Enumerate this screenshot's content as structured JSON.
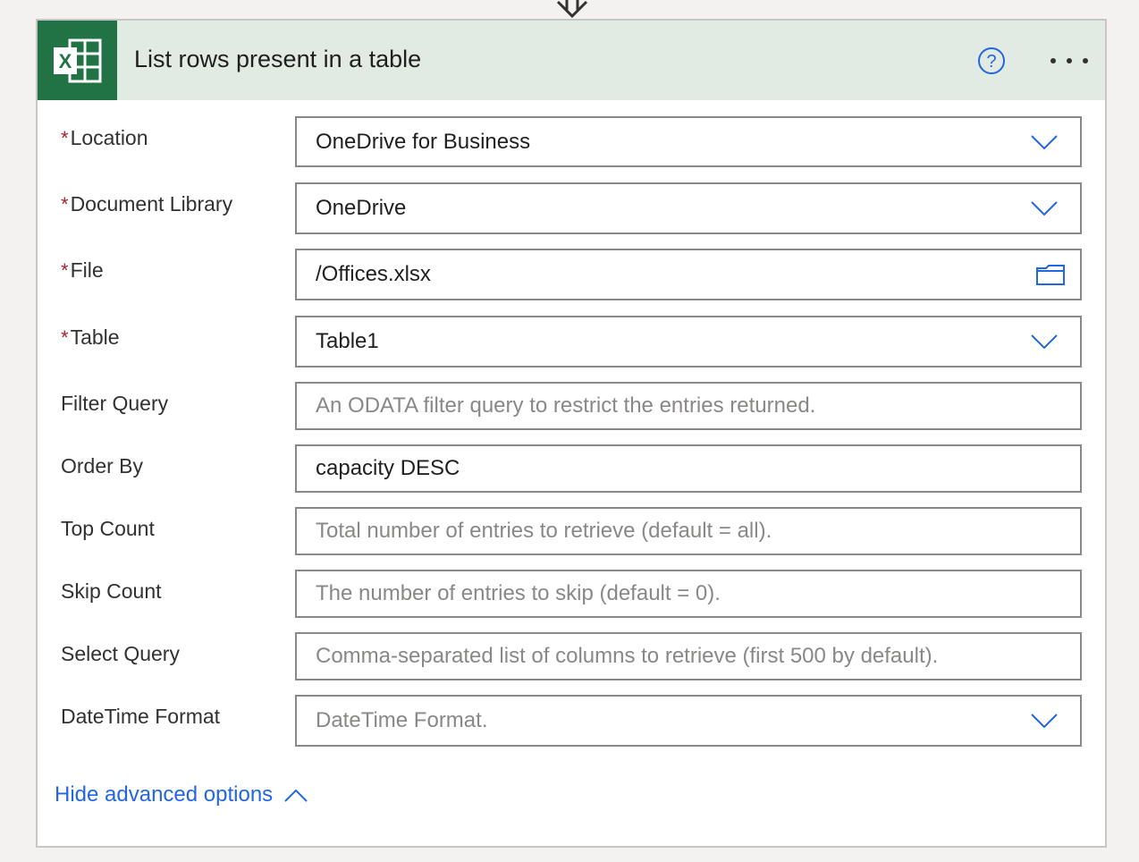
{
  "action": {
    "title": "List rows present in a table",
    "icons": {
      "app": "excel-icon",
      "help": "help-circle-icon",
      "more": "ellipsis-icon",
      "connector": "down-arrow-icon"
    },
    "colors": {
      "header_bg": "#e1ebe3",
      "excel_green": "#217346",
      "accent_blue": "#2266e3",
      "required_red": "#a4262c"
    }
  },
  "fields": [
    {
      "label": "Location",
      "required": true,
      "value": "OneDrive for Business",
      "placeholder": "",
      "control": "dropdown"
    },
    {
      "label": "Document Library",
      "required": true,
      "value": "OneDrive",
      "placeholder": "",
      "control": "dropdown"
    },
    {
      "label": "File",
      "required": true,
      "value": "/Offices.xlsx",
      "placeholder": "",
      "control": "file-picker"
    },
    {
      "label": "Table",
      "required": true,
      "value": "Table1",
      "placeholder": "",
      "control": "dropdown"
    },
    {
      "label": "Filter Query",
      "required": false,
      "value": "",
      "placeholder": "An ODATA filter query to restrict the entries returned.",
      "control": "text"
    },
    {
      "label": "Order By",
      "required": false,
      "value": "capacity DESC",
      "placeholder": "",
      "control": "text"
    },
    {
      "label": "Top Count",
      "required": false,
      "value": "",
      "placeholder": "Total number of entries to retrieve (default = all).",
      "control": "text"
    },
    {
      "label": "Skip Count",
      "required": false,
      "value": "",
      "placeholder": "The number of entries to skip (default = 0).",
      "control": "text"
    },
    {
      "label": "Select Query",
      "required": false,
      "value": "",
      "placeholder": "Comma-separated list of columns to retrieve (first 500 by default).",
      "control": "text"
    },
    {
      "label": "DateTime Format",
      "required": false,
      "value": "",
      "placeholder": "DateTime Format.",
      "control": "dropdown"
    }
  ],
  "advanced_options_label": "Hide advanced options",
  "required_marker": "*"
}
